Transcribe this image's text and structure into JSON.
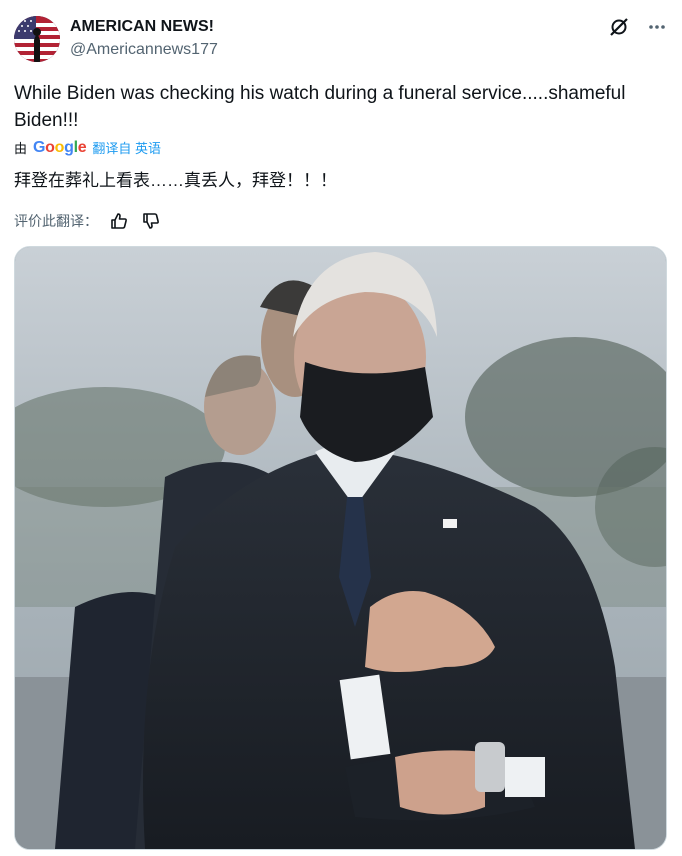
{
  "author": {
    "name": "AMERICAN NEWS!",
    "handle": "@Americannews177"
  },
  "tweet": {
    "text": "While Biden was checking his watch during a funeral service.....shameful Biden!!!",
    "translate_prefix": "由",
    "translate_brand": "Google",
    "translate_link": "翻译自 英语",
    "translated_text": "拜登在葬礼上看表……真丢人，拜登！！！",
    "rate_label": "评价此翻译："
  },
  "icons": {
    "grok": "grok-icon",
    "more": "more-icon",
    "thumbs_up": "thumbs-up-icon",
    "thumbs_down": "thumbs-down-icon"
  }
}
